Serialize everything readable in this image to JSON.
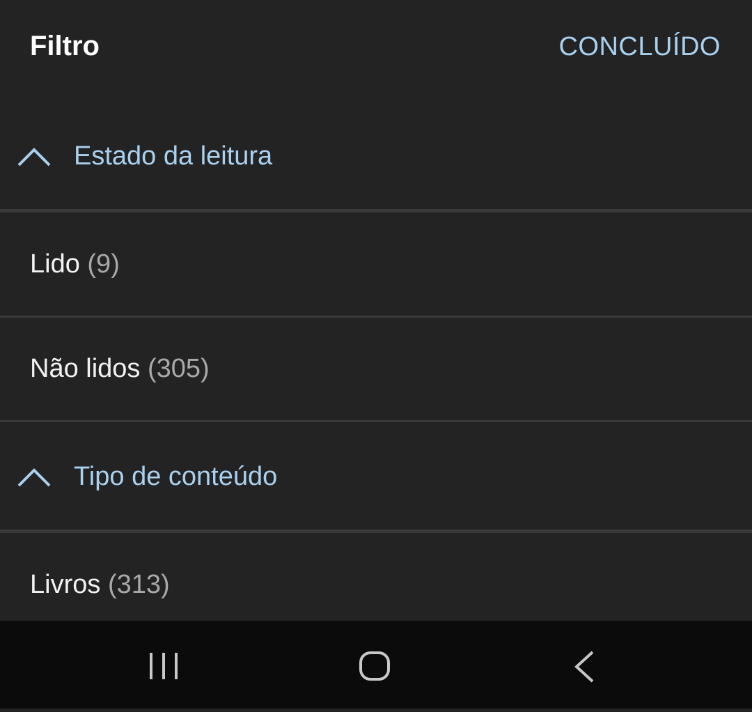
{
  "header": {
    "title": "Filtro",
    "done_label": "CONCLUÍDO"
  },
  "sections": [
    {
      "label": "Estado da leitura",
      "icon": "chevron-up-icon",
      "items": [
        {
          "label": "Lido",
          "count": "(9)"
        },
        {
          "label": "Não lidos",
          "count": "(305)"
        }
      ]
    },
    {
      "label": "Tipo de conteúdo",
      "icon": "chevron-up-icon",
      "items": [
        {
          "label": "Livros",
          "count": "(313)"
        }
      ]
    }
  ],
  "navbar": {
    "buttons": [
      "recent-apps-icon",
      "home-icon",
      "back-icon"
    ]
  },
  "colors": {
    "background": "#232323",
    "accent": "#a9d1ef",
    "text": "#f2f2f2",
    "count_text": "#a9a9a9",
    "divider": "#3a3a3a",
    "navbar": "#0b0b0b"
  }
}
